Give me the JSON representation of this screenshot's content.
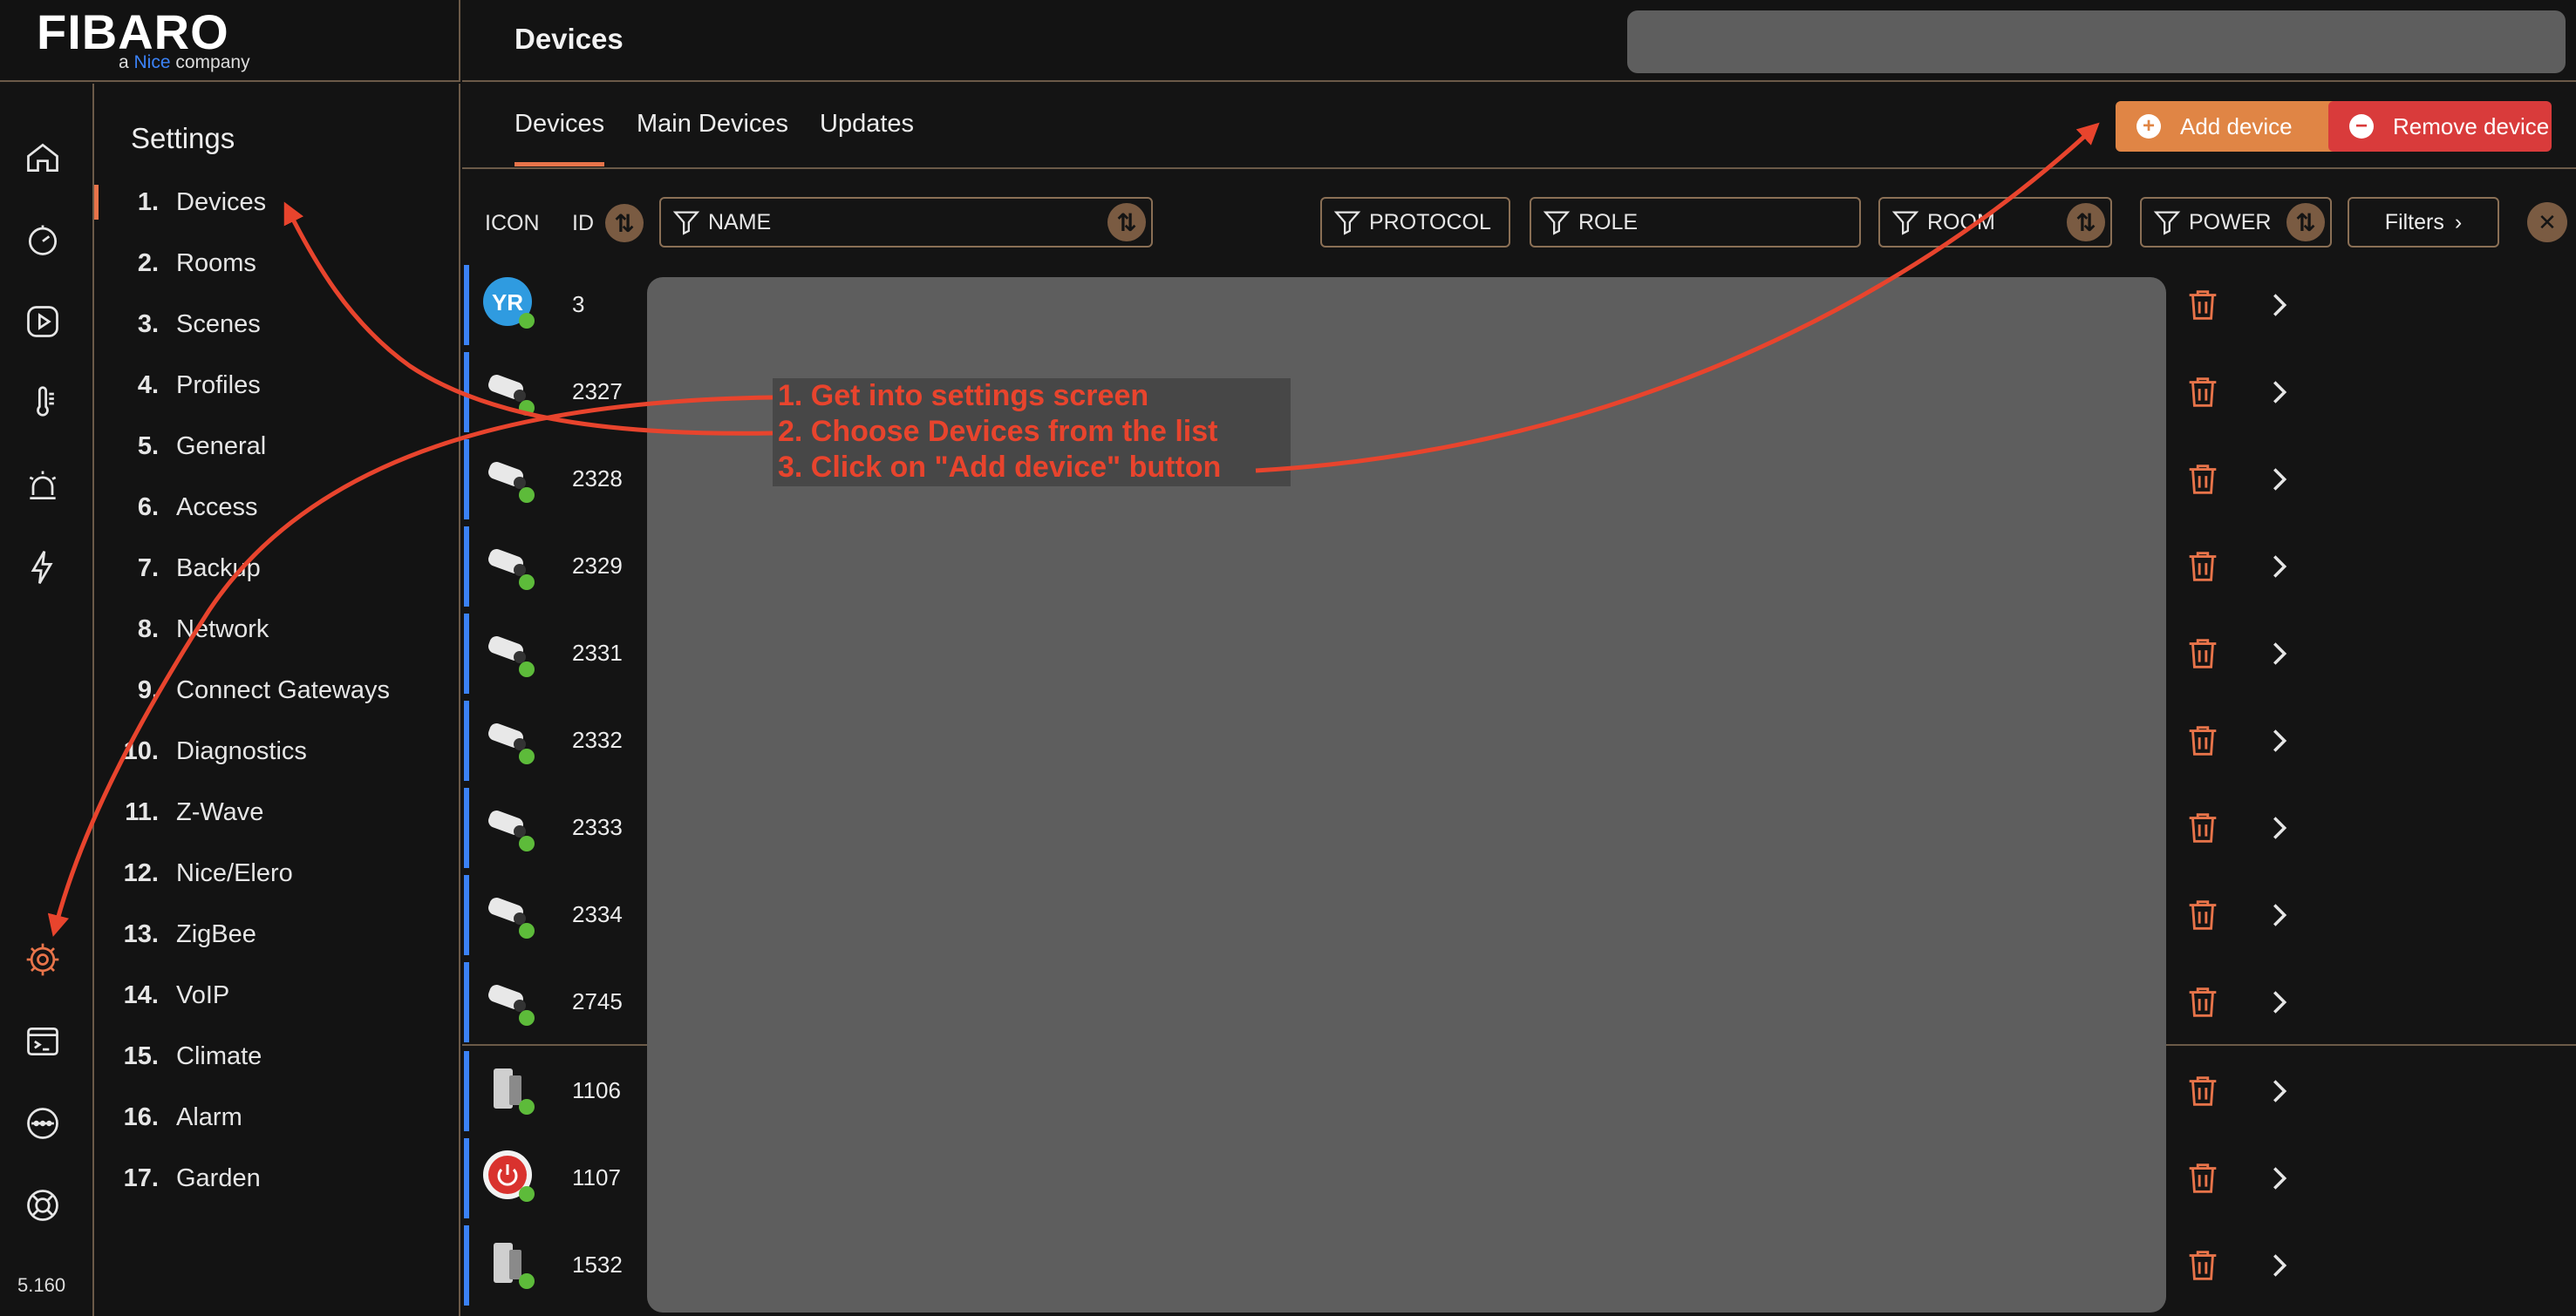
{
  "brand": {
    "logo": "FIBARO",
    "tag_prefix": "a ",
    "tag_nice": "Nice",
    "tag_suffix": " company"
  },
  "version": "5.160",
  "header": {
    "title": "Devices"
  },
  "settings": {
    "title": "Settings",
    "items": [
      {
        "num": "1.",
        "label": "Devices"
      },
      {
        "num": "2.",
        "label": "Rooms"
      },
      {
        "num": "3.",
        "label": "Scenes"
      },
      {
        "num": "4.",
        "label": "Profiles"
      },
      {
        "num": "5.",
        "label": "General"
      },
      {
        "num": "6.",
        "label": "Access"
      },
      {
        "num": "7.",
        "label": "Backup"
      },
      {
        "num": "8.",
        "label": "Network"
      },
      {
        "num": "9.",
        "label": "Connect Gateways"
      },
      {
        "num": "10.",
        "label": "Diagnostics"
      },
      {
        "num": "11.",
        "label": "Z-Wave"
      },
      {
        "num": "12.",
        "label": "Nice/Elero"
      },
      {
        "num": "13.",
        "label": "ZigBee"
      },
      {
        "num": "14.",
        "label": "VoIP"
      },
      {
        "num": "15.",
        "label": "Climate"
      },
      {
        "num": "16.",
        "label": "Alarm"
      },
      {
        "num": "17.",
        "label": "Garden"
      }
    ]
  },
  "tabs": [
    {
      "label": "Devices"
    },
    {
      "label": "Main Devices"
    },
    {
      "label": "Updates"
    }
  ],
  "buttons": {
    "add": "Add device",
    "remove": "Remove device"
  },
  "filterbar": {
    "icon": "ICON",
    "id": "ID",
    "name": "NAME",
    "protocol": "PROTOCOL",
    "role": "ROLE",
    "room": "ROOM",
    "power": "POWER",
    "filters": "Filters"
  },
  "rows": [
    {
      "id": "3",
      "icon": "yr-weather-icon"
    },
    {
      "id": "2327",
      "icon": "camera-icon"
    },
    {
      "id": "2328",
      "icon": "camera-icon"
    },
    {
      "id": "2329",
      "icon": "camera-icon"
    },
    {
      "id": "2331",
      "icon": "camera-icon"
    },
    {
      "id": "2332",
      "icon": "camera-icon"
    },
    {
      "id": "2333",
      "icon": "camera-icon"
    },
    {
      "id": "2334",
      "icon": "camera-icon"
    },
    {
      "id": "2745",
      "icon": "camera-icon"
    },
    {
      "id": "1106",
      "icon": "door-sensor-icon"
    },
    {
      "id": "1107",
      "icon": "power-switch-icon"
    },
    {
      "id": "1532",
      "icon": "door-sensor-icon"
    }
  ],
  "annotation": {
    "line1": "1. Get into settings screen",
    "line2": "2. Choose Devices from the list",
    "line3": "3. Click on \"Add device\" button"
  },
  "colors": {
    "accent": "#e8744a",
    "add_button": "#e08545",
    "remove_button": "#d93b3b",
    "row_bar": "#3b82f6",
    "annotation_text": "#e8442d"
  }
}
